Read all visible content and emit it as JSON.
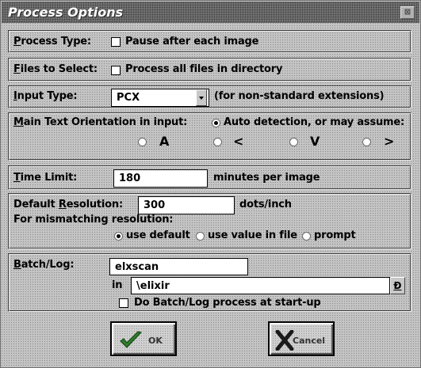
{
  "window": {
    "title": "Process Options",
    "close_glyph": "⊠"
  },
  "process_type": {
    "label_u": "P",
    "label_rest": "rocess Type:",
    "checkbox_label": "Pause after each image"
  },
  "files_to_select": {
    "label_u": "F",
    "label_rest": "iles to Select:",
    "checkbox_label": "Process all files in directory"
  },
  "input_type": {
    "label_u": "I",
    "label_rest": "nput Type:",
    "value": "PCX",
    "hint": "(for non-standard extensions)"
  },
  "orientation": {
    "label_u": "M",
    "label_rest": "ain Text Orientation in input:",
    "auto_label": "Auto detection, or may assume:",
    "options": [
      {
        "glyph": "A",
        "icon": "orientation-up-icon"
      },
      {
        "glyph": "<",
        "icon": "orientation-left-icon"
      },
      {
        "glyph": "V",
        "icon": "orientation-down-icon"
      },
      {
        "glyph": ">",
        "icon": "orientation-right-icon"
      }
    ]
  },
  "time_limit": {
    "label_u": "T",
    "label_rest": "ime Limit:",
    "value": "180",
    "unit": "minutes per image"
  },
  "resolution": {
    "label_pre": "Default ",
    "label_u": "R",
    "label_rest": "esolution:",
    "value": "300",
    "unit": "dots/inch",
    "mismatch_label": "For mismatching resolution:",
    "options": [
      "use default",
      "use value in file",
      "prompt"
    ],
    "selected": "use default"
  },
  "batch_log": {
    "label_u": "B",
    "label_rest": "atch/Log:",
    "value": "elxscan",
    "in_label": "in",
    "dir_value": "\\elixir",
    "dir_button": "D",
    "startup_label": "Do Batch/Log process at start-up"
  },
  "buttons": {
    "ok": "OK",
    "cancel": "Cancel"
  },
  "colors": {
    "face": "#c4c4c4",
    "title": "#707070",
    "accent_green": "#2e7d2e"
  }
}
